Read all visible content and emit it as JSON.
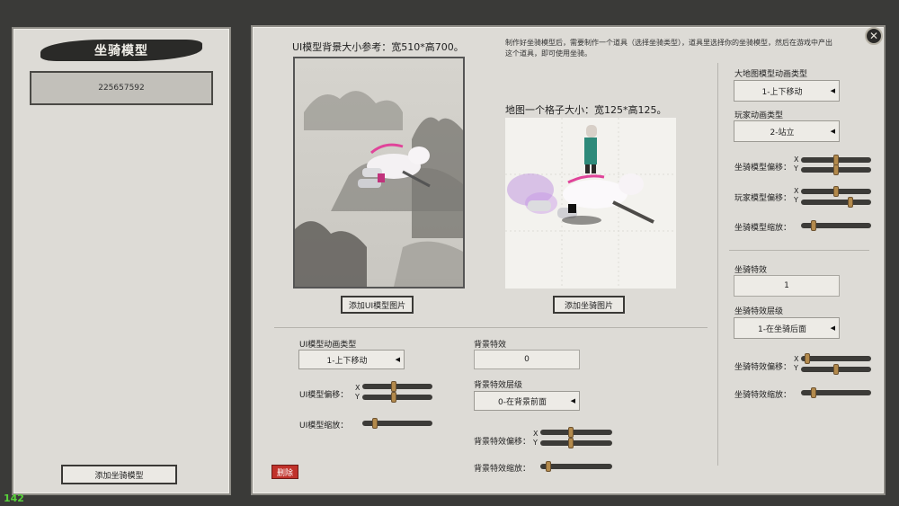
{
  "left_panel": {
    "title": "坐骑模型",
    "model_id": "225657592",
    "add_model_button": "添加坐骑模型"
  },
  "main_panel": {
    "ui_bg_size_label": "UI模型背景大小参考：宽510*高700。",
    "note_text_line1": "制作好坐骑模型后，需要制作一个道具（选择坐骑类型），道具里选择你的坐骑模型，然后在游戏中产出",
    "note_text_line2": "这个道具，即可使用坐骑。",
    "map_grid_label": "地图一个格子大小：宽125*高125。",
    "add_ui_image_button": "添加UI模型图片",
    "add_mount_image_button": "添加坐骑图片",
    "delete_button": "删除",
    "ui_model": {
      "anim_type_label": "UI模型动画类型",
      "anim_type_value": "1-上下移动",
      "offset_label": "UI模型偏移：",
      "scale_label": "UI模型缩放："
    },
    "background_fx": {
      "label": "背景特效",
      "value": "0",
      "layer_label": "背景特效层级",
      "layer_value": "0-在背景前面",
      "offset_label": "背景特效偏移：",
      "scale_label": "背景特效缩放："
    },
    "right_column": {
      "map_anim_label": "大地图模型动画类型",
      "map_anim_value": "1-上下移动",
      "player_anim_label": "玩家动画类型",
      "player_anim_value": "2-站立",
      "mount_offset_label": "坐骑模型偏移：",
      "player_offset_label": "玩家模型偏移：",
      "mount_scale_label": "坐骑模型缩放：",
      "mount_fx_label": "坐骑特效",
      "mount_fx_value": "1",
      "mount_fx_layer_label": "坐骑特效层级",
      "mount_fx_layer_value": "1-在坐骑后面",
      "mount_fx_offset_label": "坐骑特效偏移：",
      "mount_fx_scale_label": "坐骑特效缩放："
    },
    "axis_x": "X",
    "axis_y": "Y"
  },
  "fps_counter": "142",
  "slider_levels": {
    "ui_offset_x": 0.45,
    "ui_offset_y": 0.45,
    "ui_scale": 0.15,
    "bg_offset_x": 0.42,
    "bg_offset_y": 0.42,
    "bg_scale": 0.08,
    "mount_offset_x": 0.5,
    "mount_offset_y": 0.5,
    "player_offset_x": 0.5,
    "player_offset_y": 0.72,
    "mount_scale": 0.15,
    "mount_fx_offset_x": 0.05,
    "mount_fx_offset_y": 0.5,
    "mount_fx_scale": 0.15
  },
  "colors": {
    "panel_bg": "#dddbd6",
    "slider_track": "#3c3b38",
    "slider_knob": "#b38a4c",
    "delete_red": "#c0322b",
    "fps_green": "#58d23a"
  }
}
